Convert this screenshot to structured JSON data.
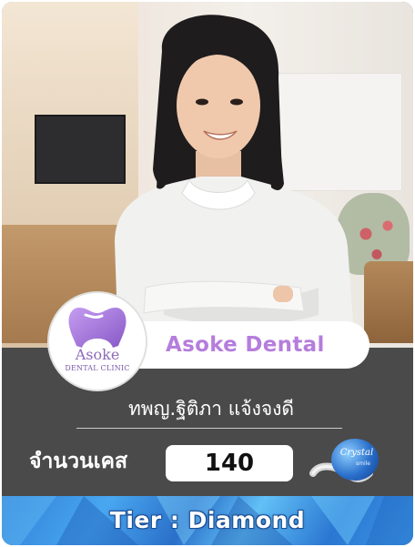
{
  "clinic": {
    "name": "Asoke Dental",
    "logo_word": "Asoke",
    "logo_sub": "DENTAL CLINIC",
    "logo_color": "#b57ddc"
  },
  "doctor": {
    "name": "ทพญ.ฐิติภา แจ้งจงดี"
  },
  "cases": {
    "label": "จำนวนเคส",
    "value": "140"
  },
  "badge": {
    "brand": "Crystal",
    "brand_sub": "smile",
    "icon": "crystal-smile-aligner-icon"
  },
  "tier": {
    "text": "Tier  : Diamond",
    "color": "#2f7fd6"
  },
  "colors": {
    "panel": "#4a4a4b",
    "accent": "#b57ddc"
  }
}
